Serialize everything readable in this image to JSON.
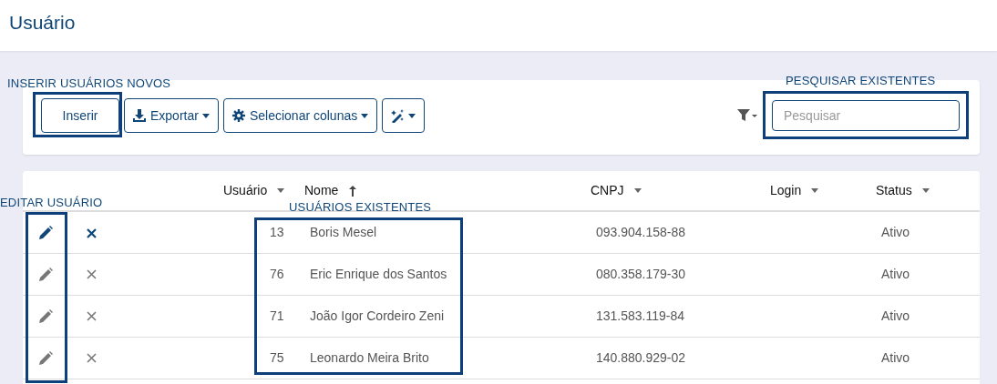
{
  "page_title": "Usuário",
  "toolbar": {
    "buttons": [
      {
        "label": "Inserir",
        "kind": "plain"
      },
      {
        "label": "Exportar",
        "kind": "export"
      },
      {
        "label": "Selecionar colunas",
        "kind": "columns"
      },
      {
        "kind": "wand"
      }
    ],
    "search": {
      "placeholder": "Pesquisar"
    }
  },
  "table": {
    "columns": [
      {
        "label": "Usuário",
        "sorted": false
      },
      {
        "label": "Nome",
        "sorted": true
      },
      {
        "label": "CNPJ",
        "sorted": false
      },
      {
        "label": "Login",
        "sorted": false
      },
      {
        "label": "Status",
        "sorted": false
      }
    ],
    "rows": [
      {
        "highlighted": true,
        "usuario": "13",
        "nome": "Boris Mesel",
        "cnpj": "093.904.158-88",
        "status": "Ativo"
      },
      {
        "highlighted": false,
        "usuario": "76",
        "nome": "Eric Enrique dos Santos",
        "cnpj": "080.358.179-30",
        "status": "Ativo"
      },
      {
        "highlighted": false,
        "usuario": "71",
        "nome": "João Igor Cordeiro Zeni",
        "cnpj": "131.583.119-84",
        "status": "Ativo"
      },
      {
        "highlighted": false,
        "usuario": "75",
        "nome": "Leonardo Meira Brito",
        "cnpj": "140.880.929-02",
        "status": "Ativo"
      }
    ]
  },
  "annotations": [
    {
      "label": "INSERIR USUÁRIOS NOVOS"
    },
    {
      "label": "PESQUISAR EXISTENTES"
    },
    {
      "label": "EDITAR USUÁRIO"
    },
    {
      "label": "USUÁRIOS EXISTENTES"
    }
  ]
}
